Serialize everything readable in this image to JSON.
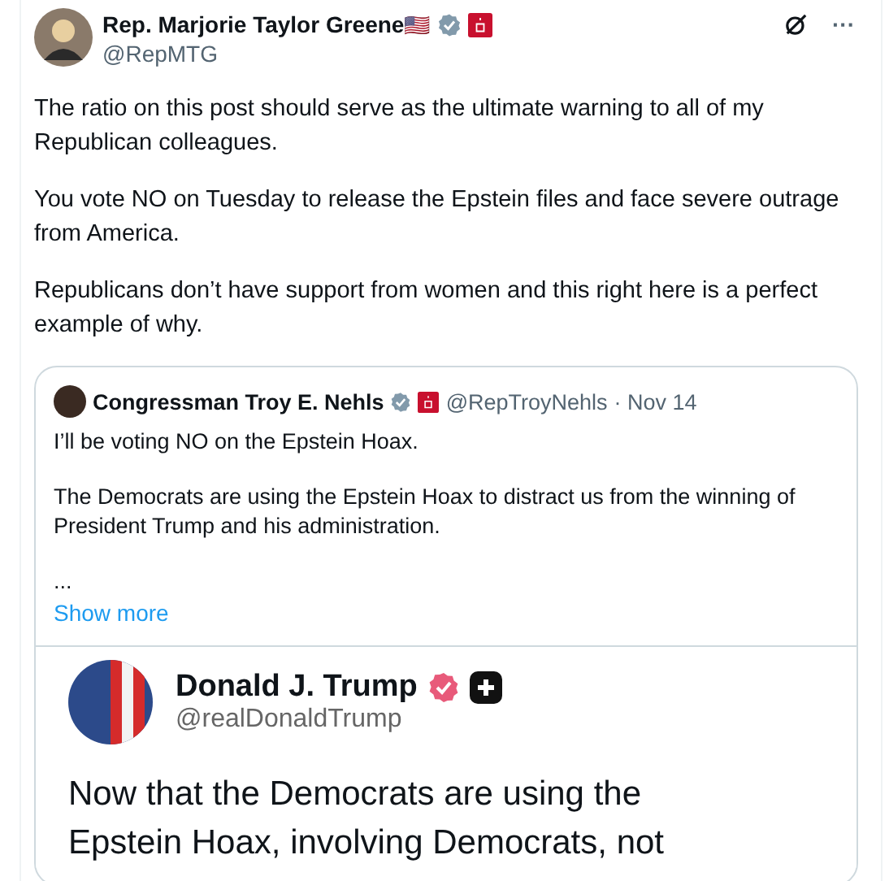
{
  "post": {
    "author": {
      "name": "Rep. Marjorie Taylor Greene",
      "flag": "🇺🇸",
      "verified": true,
      "handle": "@RepMTG"
    },
    "paragraphs": [
      "The ratio on this post should serve as the ultimate warning to all of my Republican colleagues.",
      "You vote NO on Tuesday to release the Epstein files and face severe outrage from America.",
      "Republicans don’t have support from women and this right here is a perfect example of why."
    ],
    "more": "···",
    "quote": {
      "author": {
        "name": "Congressman Troy E. Nehls",
        "verified": true,
        "handle": "@RepTroyNehls",
        "date": "· Nov 14"
      },
      "paragraphs": [
        "I’ll be voting NO on the Epstein Hoax.",
        "The Democrats are using the Epstein Hoax to distract us from the winning of President Trump and his administration.",
        "..."
      ],
      "show_more": "Show more",
      "image": {
        "name": "Donald J. Trump",
        "verified": true,
        "handle": "@realDonaldTrump",
        "text": "Now that the Democrats are using the Epstein Hoax, involving Democrats, not"
      }
    }
  }
}
